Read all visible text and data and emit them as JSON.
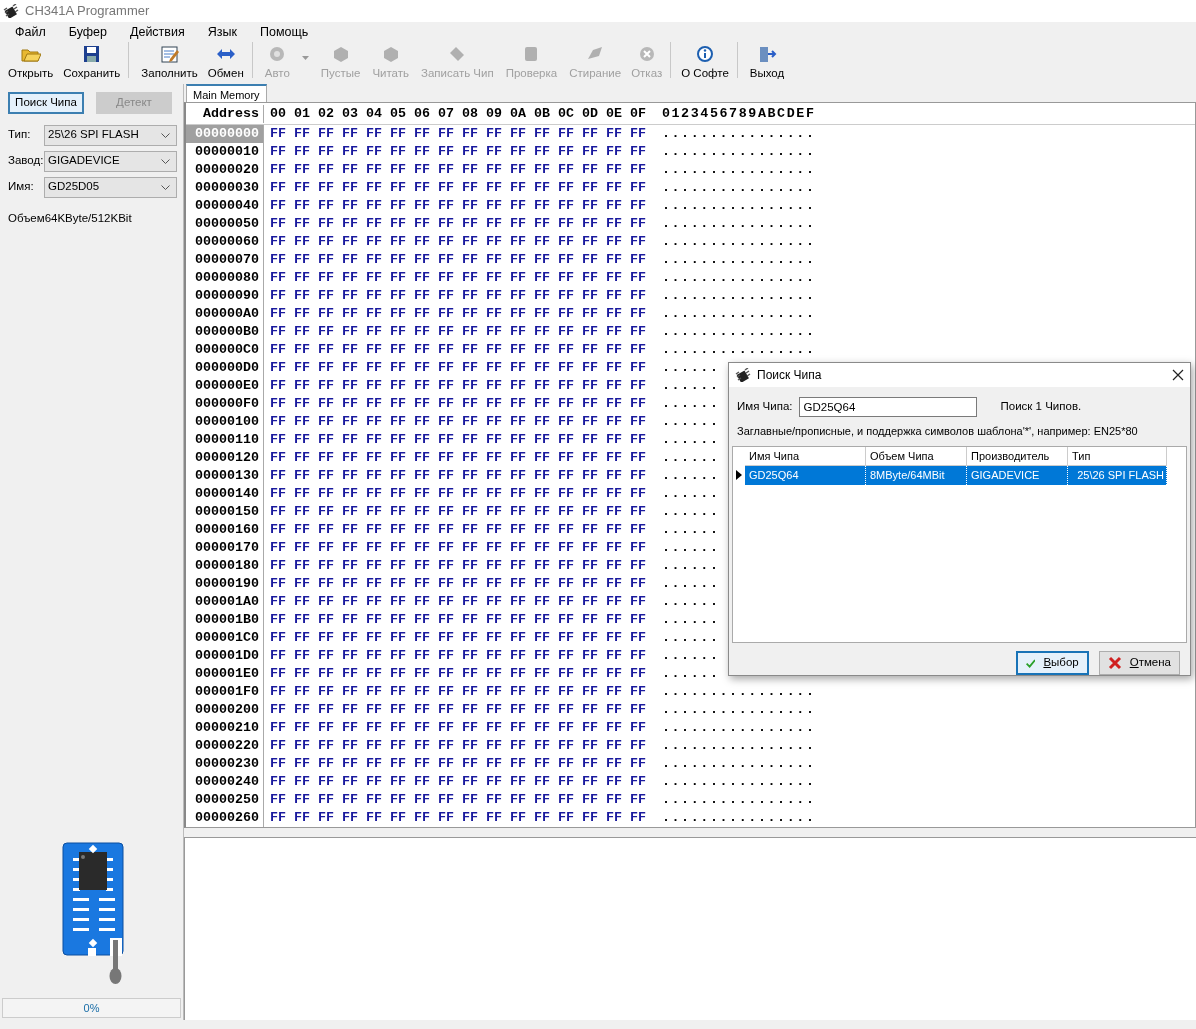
{
  "window": {
    "title": "CH341A Programmer"
  },
  "menu": [
    "Файл",
    "Буфер",
    "Действия",
    "Язык",
    "Помощь"
  ],
  "toolbar": [
    {
      "label": "Открыть",
      "disabled": false,
      "separator_after": false,
      "dropdown": false
    },
    {
      "label": "Сохранить",
      "disabled": false,
      "separator_after": true,
      "dropdown": false
    },
    {
      "label": "Заполнить",
      "disabled": false,
      "separator_after": false,
      "dropdown": false
    },
    {
      "label": "Обмен",
      "disabled": false,
      "separator_after": true,
      "dropdown": false
    },
    {
      "label": "Авто",
      "disabled": true,
      "separator_after": false,
      "dropdown": true
    },
    {
      "label": "Пустые",
      "disabled": true,
      "separator_after": false,
      "dropdown": false
    },
    {
      "label": "Читать",
      "disabled": true,
      "separator_after": false,
      "dropdown": false
    },
    {
      "label": "Записать Чип",
      "disabled": true,
      "separator_after": false,
      "dropdown": false
    },
    {
      "label": "Проверка",
      "disabled": true,
      "separator_after": false,
      "dropdown": false
    },
    {
      "label": "Стирание",
      "disabled": true,
      "separator_after": false,
      "dropdown": false
    },
    {
      "label": "Отказ",
      "disabled": true,
      "separator_after": true,
      "dropdown": false
    },
    {
      "label": "О Софте",
      "disabled": false,
      "separator_after": true,
      "dropdown": false
    },
    {
      "label": "Выход",
      "disabled": false,
      "separator_after": false,
      "dropdown": false
    }
  ],
  "left_panel": {
    "buttons": [
      {
        "label": "Поиск Чипа",
        "disabled": false
      },
      {
        "label": "Детект",
        "disabled": true
      }
    ],
    "selects": [
      {
        "label": "Тип:",
        "value": "25\\26 SPI FLASH"
      },
      {
        "label": "Завод:",
        "value": "GIGADEVICE"
      },
      {
        "label": "Имя:",
        "value": "GD25D05"
      }
    ],
    "size_label": "Объем",
    "size_value": "64KByte/512KBit",
    "progress": {
      "level": 0,
      "reading": "0%"
    }
  },
  "tabs": [
    {
      "label": "Main Memory",
      "selected": true
    }
  ],
  "hex_view": {
    "address_header": "Address",
    "columns": [
      "00",
      "01",
      "02",
      "03",
      "04",
      "05",
      "06",
      "07",
      "08",
      "09",
      "0A",
      "0B",
      "0C",
      "0D",
      "0E",
      "0F"
    ],
    "ascii_header": "0123456789ABCDEF",
    "rows": [
      {
        "address": "00000000",
        "hex": "FF FF FF FF FF FF FF FF FF FF FF FF FF FF FF FF",
        "ascii": "................",
        "selected": true
      },
      {
        "address": "00000010",
        "hex": "FF FF FF FF FF FF FF FF FF FF FF FF FF FF FF FF",
        "ascii": "................",
        "selected": false
      },
      {
        "address": "00000020",
        "hex": "FF FF FF FF FF FF FF FF FF FF FF FF FF FF FF FF",
        "ascii": "................",
        "selected": false
      },
      {
        "address": "00000030",
        "hex": "FF FF FF FF FF FF FF FF FF FF FF FF FF FF FF FF",
        "ascii": "................",
        "selected": false
      },
      {
        "address": "00000040",
        "hex": "FF FF FF FF FF FF FF FF FF FF FF FF FF FF FF FF",
        "ascii": "................",
        "selected": false
      },
      {
        "address": "00000050",
        "hex": "FF FF FF FF FF FF FF FF FF FF FF FF FF FF FF FF",
        "ascii": "................",
        "selected": false
      },
      {
        "address": "00000060",
        "hex": "FF FF FF FF FF FF FF FF FF FF FF FF FF FF FF FF",
        "ascii": "................",
        "selected": false
      },
      {
        "address": "00000070",
        "hex": "FF FF FF FF FF FF FF FF FF FF FF FF FF FF FF FF",
        "ascii": "................",
        "selected": false
      },
      {
        "address": "00000080",
        "hex": "FF FF FF FF FF FF FF FF FF FF FF FF FF FF FF FF",
        "ascii": "................",
        "selected": false
      },
      {
        "address": "00000090",
        "hex": "FF FF FF FF FF FF FF FF FF FF FF FF FF FF FF FF",
        "ascii": "................",
        "selected": false
      },
      {
        "address": "000000A0",
        "hex": "FF FF FF FF FF FF FF FF FF FF FF FF FF FF FF FF",
        "ascii": "................",
        "selected": false
      },
      {
        "address": "000000B0",
        "hex": "FF FF FF FF FF FF FF FF FF FF FF FF FF FF FF FF",
        "ascii": "................",
        "selected": false
      },
      {
        "address": "000000C0",
        "hex": "FF FF FF FF FF FF FF FF FF FF FF FF FF FF FF FF",
        "ascii": "................",
        "selected": false
      },
      {
        "address": "000000D0",
        "hex": "FF FF FF FF FF FF FF FF FF FF FF FF FF FF FF FF",
        "ascii": "......",
        "selected": false
      },
      {
        "address": "000000E0",
        "hex": "FF FF FF FF FF FF FF FF FF FF FF FF FF FF FF FF",
        "ascii": "......",
        "selected": false
      },
      {
        "address": "000000F0",
        "hex": "FF FF FF FF FF FF FF FF FF FF FF FF FF FF FF FF",
        "ascii": "......",
        "selected": false
      },
      {
        "address": "00000100",
        "hex": "FF FF FF FF FF FF FF FF FF FF FF FF FF FF FF FF",
        "ascii": "......",
        "selected": false
      },
      {
        "address": "00000110",
        "hex": "FF FF FF FF FF FF FF FF FF FF FF FF FF FF FF FF",
        "ascii": "......",
        "selected": false
      },
      {
        "address": "00000120",
        "hex": "FF FF FF FF FF FF FF FF FF FF FF FF FF FF FF FF",
        "ascii": "......",
        "selected": false
      },
      {
        "address": "00000130",
        "hex": "FF FF FF FF FF FF FF FF FF FF FF FF FF FF FF FF",
        "ascii": "......",
        "selected": false
      },
      {
        "address": "00000140",
        "hex": "FF FF FF FF FF FF FF FF FF FF FF FF FF FF FF FF",
        "ascii": "......",
        "selected": false
      },
      {
        "address": "00000150",
        "hex": "FF FF FF FF FF FF FF FF FF FF FF FF FF FF FF FF",
        "ascii": "......",
        "selected": false
      },
      {
        "address": "00000160",
        "hex": "FF FF FF FF FF FF FF FF FF FF FF FF FF FF FF FF",
        "ascii": "......",
        "selected": false
      },
      {
        "address": "00000170",
        "hex": "FF FF FF FF FF FF FF FF FF FF FF FF FF FF FF FF",
        "ascii": "......",
        "selected": false
      },
      {
        "address": "00000180",
        "hex": "FF FF FF FF FF FF FF FF FF FF FF FF FF FF FF FF",
        "ascii": "......",
        "selected": false
      },
      {
        "address": "00000190",
        "hex": "FF FF FF FF FF FF FF FF FF FF FF FF FF FF FF FF",
        "ascii": "......",
        "selected": false
      },
      {
        "address": "000001A0",
        "hex": "FF FF FF FF FF FF FF FF FF FF FF FF FF FF FF FF",
        "ascii": "......",
        "selected": false
      },
      {
        "address": "000001B0",
        "hex": "FF FF FF FF FF FF FF FF FF FF FF FF FF FF FF FF",
        "ascii": "......",
        "selected": false
      },
      {
        "address": "000001C0",
        "hex": "FF FF FF FF FF FF FF FF FF FF FF FF FF FF FF FF",
        "ascii": "......",
        "selected": false
      },
      {
        "address": "000001D0",
        "hex": "FF FF FF FF FF FF FF FF FF FF FF FF FF FF FF FF",
        "ascii": "......",
        "selected": false
      },
      {
        "address": "000001E0",
        "hex": "FF FF FF FF FF FF FF FF FF FF FF FF FF FF FF FF",
        "ascii": "......",
        "selected": false
      },
      {
        "address": "000001F0",
        "hex": "FF FF FF FF FF FF FF FF FF FF FF FF FF FF FF FF",
        "ascii": "................",
        "selected": false
      },
      {
        "address": "00000200",
        "hex": "FF FF FF FF FF FF FF FF FF FF FF FF FF FF FF FF",
        "ascii": "................",
        "selected": false
      },
      {
        "address": "00000210",
        "hex": "FF FF FF FF FF FF FF FF FF FF FF FF FF FF FF FF",
        "ascii": "................",
        "selected": false
      },
      {
        "address": "00000220",
        "hex": "FF FF FF FF FF FF FF FF FF FF FF FF FF FF FF FF",
        "ascii": "................",
        "selected": false
      },
      {
        "address": "00000230",
        "hex": "FF FF FF FF FF FF FF FF FF FF FF FF FF FF FF FF",
        "ascii": "................",
        "selected": false
      },
      {
        "address": "00000240",
        "hex": "FF FF FF FF FF FF FF FF FF FF FF FF FF FF FF FF",
        "ascii": "................",
        "selected": false
      },
      {
        "address": "00000250",
        "hex": "FF FF FF FF FF FF FF FF FF FF FF FF FF FF FF FF",
        "ascii": "................",
        "selected": false
      },
      {
        "address": "00000260",
        "hex": "FF FF FF FF FF FF FF FF FF FF FF FF FF FF FF FF",
        "ascii": "................",
        "selected": false
      }
    ]
  },
  "dialog": {
    "title": "Поиск Чипа",
    "field_label": "Имя Чипа:",
    "field_value": "GD25Q64",
    "result": "Поиск 1 Чипов.",
    "hint": "Заглавные/прописные, и поддержка символов шаблона'*', например: EN25*80",
    "columns": [
      "Имя Чипа",
      "Объем Чипа",
      "Производитель",
      "Тип"
    ],
    "rows": [
      {
        "cells": [
          "GD25Q64",
          "8MByte/64MBit",
          "GIGADEVICE",
          "25\\26 SPI FLASH"
        ],
        "selected": true
      }
    ],
    "buttons": [
      {
        "label": "Выбор",
        "kind": "ok"
      },
      {
        "label": "Отмена",
        "kind": "cancel"
      }
    ]
  }
}
